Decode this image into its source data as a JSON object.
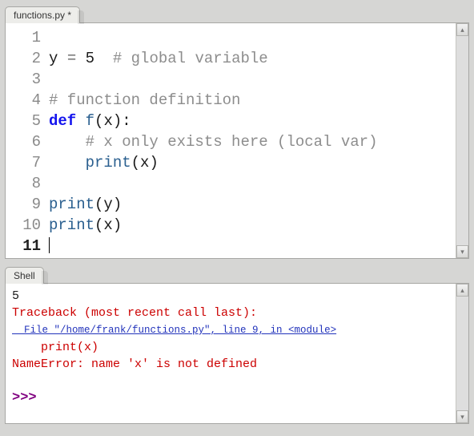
{
  "editor": {
    "tab_label": "functions.py *",
    "gutter": [
      "1",
      "2",
      "3",
      "4",
      "5",
      "6",
      "7",
      "8",
      "9",
      "10",
      "11"
    ],
    "current_line_index": 10,
    "code_lines": [
      [],
      [
        {
          "t": "y",
          "c": "tok-name"
        },
        {
          "t": " ",
          "c": ""
        },
        {
          "t": "=",
          "c": "tok-op"
        },
        {
          "t": " ",
          "c": ""
        },
        {
          "t": "5",
          "c": "tok-num"
        },
        {
          "t": "  ",
          "c": ""
        },
        {
          "t": "# global variable",
          "c": "tok-comment"
        }
      ],
      [],
      [
        {
          "t": "# function definition",
          "c": "tok-comment"
        }
      ],
      [
        {
          "t": "def",
          "c": "tok-kw"
        },
        {
          "t": " ",
          "c": ""
        },
        {
          "t": "f",
          "c": "tok-func"
        },
        {
          "t": "(",
          "c": "tok-punct"
        },
        {
          "t": "x",
          "c": "tok-name"
        },
        {
          "t": ")",
          "c": "tok-punct"
        },
        {
          "t": ":",
          "c": "tok-punct"
        }
      ],
      [
        {
          "t": "    ",
          "c": ""
        },
        {
          "t": "# x only exists here (local var)",
          "c": "tok-comment"
        }
      ],
      [
        {
          "t": "    ",
          "c": ""
        },
        {
          "t": "print",
          "c": "tok-func"
        },
        {
          "t": "(",
          "c": "tok-punct"
        },
        {
          "t": "x",
          "c": "tok-name"
        },
        {
          "t": ")",
          "c": "tok-punct"
        }
      ],
      [],
      [
        {
          "t": "print",
          "c": "tok-func"
        },
        {
          "t": "(",
          "c": "tok-punct"
        },
        {
          "t": "y",
          "c": "tok-name"
        },
        {
          "t": ")",
          "c": "tok-punct"
        }
      ],
      [
        {
          "t": "print",
          "c": "tok-func"
        },
        {
          "t": "(",
          "c": "tok-punct"
        },
        {
          "t": "x",
          "c": "tok-name"
        },
        {
          "t": ")",
          "c": "tok-punct"
        }
      ],
      []
    ]
  },
  "shell": {
    "tab_label": "Shell",
    "output": {
      "val": "5",
      "tb_header": "Traceback (most recent call last):",
      "tb_file": "  File \"/home/frank/functions.py\", line 9, in <module>",
      "tb_code": "    print(x)",
      "tb_err": "NameError: name 'x' is not defined",
      "prompt": ">>>"
    }
  }
}
